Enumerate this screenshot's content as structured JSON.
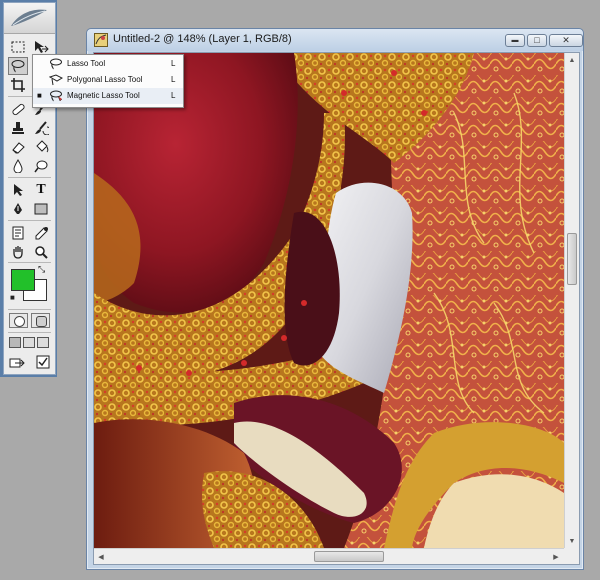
{
  "document": {
    "title": "Untitled-2 @ 148% (Layer 1, RGB/8)",
    "window_buttons": {
      "minimize": "▬",
      "maximize": "□",
      "close": "✕"
    }
  },
  "toolbox": {
    "foreground_color": "#22c02a",
    "background_color": "#ffffff",
    "tools": [
      {
        "name": "marquee",
        "icon": "marquee-icon"
      },
      {
        "name": "move",
        "icon": "move-icon"
      },
      {
        "name": "lasso",
        "icon": "lasso-icon",
        "active": true
      },
      {
        "name": "crop",
        "icon": "crop-icon"
      },
      {
        "name": "healing",
        "icon": "bandage-icon"
      },
      {
        "name": "stamp",
        "icon": "stamp-icon"
      },
      {
        "name": "history-brush",
        "icon": "history-brush-icon"
      },
      {
        "name": "eraser",
        "icon": "eraser-icon"
      },
      {
        "name": "blur",
        "icon": "drop-icon"
      },
      {
        "name": "dodge",
        "icon": "dodge-icon"
      },
      {
        "name": "path-selection",
        "icon": "arrow-icon"
      },
      {
        "name": "type",
        "icon": "type-icon"
      },
      {
        "name": "pen",
        "icon": "pen-icon"
      },
      {
        "name": "shape",
        "icon": "rectangle-icon"
      },
      {
        "name": "notes",
        "icon": "notes-icon"
      },
      {
        "name": "eyedropper",
        "icon": "eyedropper-icon"
      },
      {
        "name": "hand",
        "icon": "hand-icon"
      },
      {
        "name": "zoom",
        "icon": "zoom-icon"
      }
    ],
    "type_glyph": "T"
  },
  "flyout": {
    "items": [
      {
        "label": "Lasso Tool",
        "shortcut": "L",
        "icon": "lasso-icon",
        "selected": false
      },
      {
        "label": "Polygonal Lasso Tool",
        "shortcut": "L",
        "icon": "polygonal-lasso-icon",
        "selected": false
      },
      {
        "label": "Magnetic Lasso Tool",
        "shortcut": "L",
        "icon": "magnetic-lasso-icon",
        "selected": true
      }
    ],
    "bullet": "■"
  },
  "scrollbar": {
    "v_up": "▲",
    "v_down": "▼",
    "h_left": "◀",
    "h_right": "▶"
  },
  "colors": {
    "toolbox_border": "#5a7ea8",
    "window_frame": "#c4d4e6",
    "workspace": "#a9a9a9"
  }
}
